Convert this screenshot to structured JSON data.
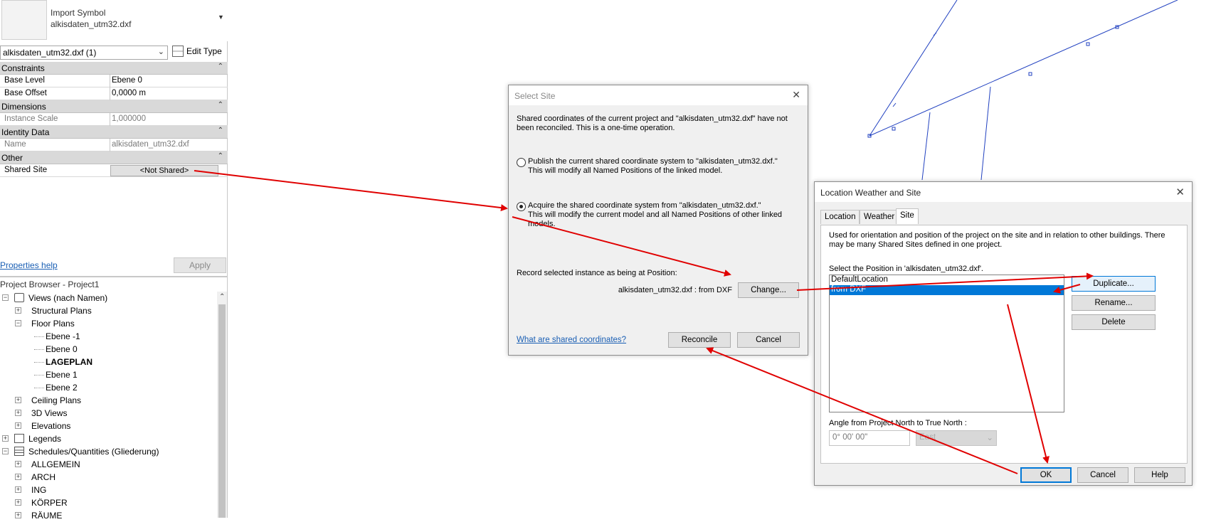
{
  "properties": {
    "type_selector": {
      "line1": "Import Symbol",
      "line2": "alkisdaten_utm32.dxf"
    },
    "instance_filter": "alkisdaten_utm32.dxf (1)",
    "edit_type_label": "Edit Type",
    "groups": {
      "constraints": "Constraints",
      "dimensions": "Dimensions",
      "identity": "Identity Data",
      "other": "Other"
    },
    "rows": {
      "base_level": {
        "name": "Base Level",
        "value": "Ebene 0"
      },
      "base_offset": {
        "name": "Base Offset",
        "value": "0,0000 m"
      },
      "instance_scale": {
        "name": "Instance Scale",
        "value": "1,000000"
      },
      "name": {
        "name": "Name",
        "value": "alkisdaten_utm32.dxf"
      },
      "shared_site": {
        "name": "Shared Site",
        "value": "<Not Shared>"
      }
    },
    "help_link": "Properties help",
    "apply_label": "Apply"
  },
  "project_browser": {
    "title": "Project Browser - Project1",
    "items": [
      "Views (nach Namen)",
      "Structural Plans",
      "Floor Plans",
      "Ebene -1",
      "Ebene 0",
      "LAGEPLAN",
      "Ebene 1",
      "Ebene 2",
      "Ceiling Plans",
      "3D Views",
      "Elevations",
      "Legends",
      "Schedules/Quantities (Gliederung)",
      "ALLGEMEIN",
      "ARCH",
      "ING",
      "KÖRPER",
      "RÄUME"
    ]
  },
  "select_site": {
    "title": "Select Site",
    "message": "Shared coordinates of the current project and \"alkisdaten_utm32.dxf\" have not been reconciled. This is a one-time operation.",
    "option_publish": {
      "line1": "Publish the current shared coordinate system to \"alkisdaten_utm32.dxf.\"",
      "line2": "This will modify all Named Positions of the linked model."
    },
    "option_acquire": {
      "line1": "Acquire the shared coordinate system from \"alkisdaten_utm32.dxf.\"",
      "line2": "This will modify the current model and all Named Positions of other linked models."
    },
    "record_label": "Record selected instance as being at Position:",
    "position_value": "alkisdaten_utm32.dxf : from DXF",
    "change_label": "Change...",
    "help_link": "What are shared coordinates?",
    "reconcile_label": "Reconcile",
    "cancel_label": "Cancel"
  },
  "location_dialog": {
    "title": "Location Weather and Site",
    "tabs": [
      "Location",
      "Weather",
      "Site"
    ],
    "description": "Used for orientation and position of the project on the site and in relation to other buildings. There may be many Shared Sites defined in one project.",
    "select_label": "Select the Position in 'alkisdaten_utm32.dxf'.",
    "positions": [
      "DefaultLocation",
      "from DXF"
    ],
    "duplicate_label": "Duplicate...",
    "rename_label": "Rename...",
    "delete_label": "Delete",
    "angle_label": "Angle from Project North to True North :",
    "angle_value": "0° 00' 00\"",
    "direction_value": "East",
    "ok_label": "OK",
    "cancel_label": "Cancel",
    "help_label": "Help"
  },
  "colors": {
    "annotation": "#e00000",
    "drawing": "#2040c0",
    "selection": "#0078d7"
  }
}
